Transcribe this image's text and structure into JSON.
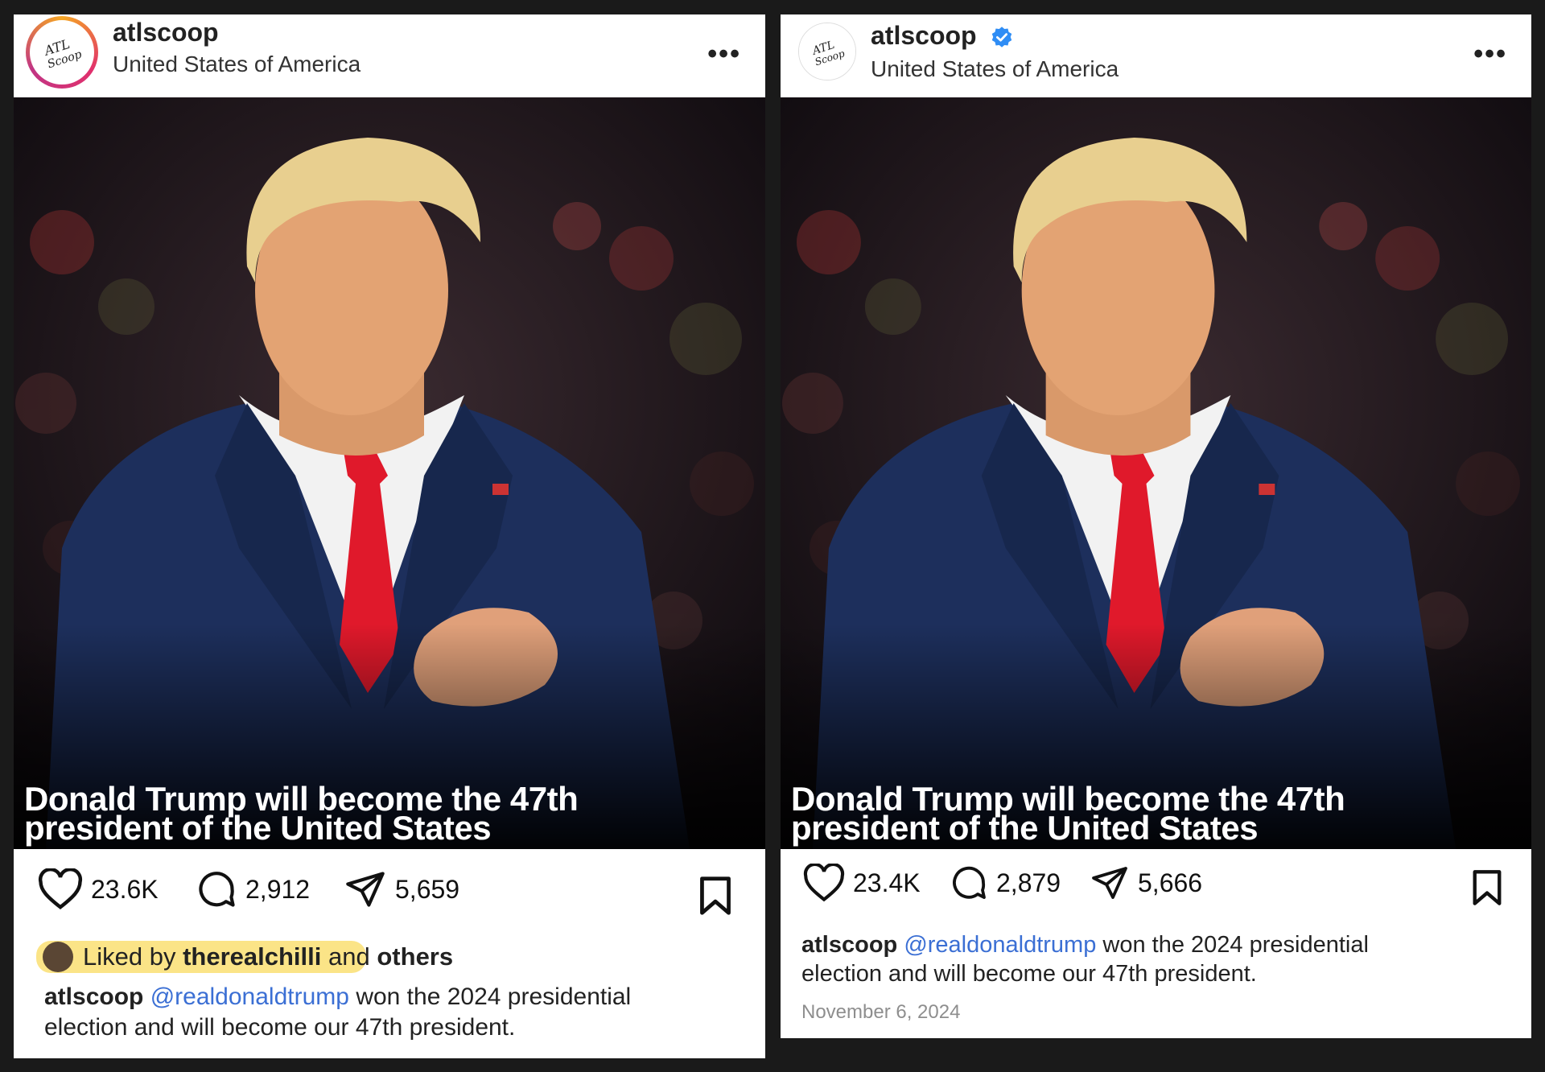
{
  "left_post": {
    "username": "atlscoop",
    "location": "United States of America",
    "more": "•••",
    "overlay_line1": "Donald Trump will become the 47th",
    "overlay_line2": "president of the United States",
    "likes": "23.6K",
    "comments": "2,912",
    "shares": "5,659",
    "liked_prefix": "Liked by",
    "liked_user": "therealchilli",
    "liked_and": "and",
    "liked_others": "others",
    "caption_user": "atlscoop",
    "caption_mention": "@realdonaldtrump",
    "caption_line1_rest": "won the 2024 presidential",
    "caption_line2": "election and will become our 47th president."
  },
  "right_post": {
    "username": "atlscoop",
    "location": "United States of America",
    "more": "•••",
    "overlay_line1": "Donald Trump will become the 47th",
    "overlay_line2": "president of the United States",
    "likes": "23.4K",
    "comments": "2,879",
    "shares": "5,666",
    "caption_user": "atlscoop",
    "caption_mention": "@realdonaldtrump",
    "caption_line1_rest": "won the 2024 presidential",
    "caption_line2": "election and will become our 47th president.",
    "date": "November 6, 2024"
  },
  "colors": {
    "mention": "#3b6fd4",
    "highlight": "#fbe17a",
    "verified": "#2f8df5",
    "tie": "#e0192b",
    "suit": "#1d2f5c"
  },
  "icons": [
    "heart-icon",
    "comment-icon",
    "share-icon",
    "bookmark-icon",
    "verified-icon",
    "more-icon"
  ]
}
